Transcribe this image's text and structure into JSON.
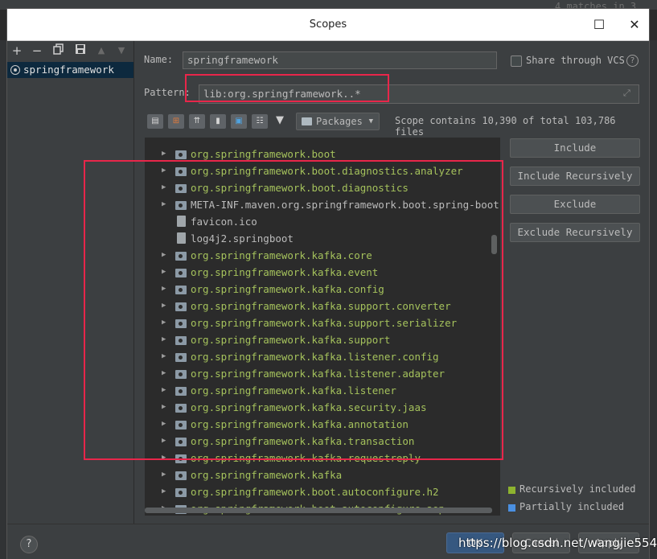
{
  "background": {
    "top_right_text": "4 matches in 3 fil"
  },
  "dialog": {
    "title": "Scopes",
    "maximize_glyph": "☐",
    "close_glyph": "✕"
  },
  "left_toolbar": {
    "icons": [
      "add-icon",
      "remove-icon",
      "copy-icon",
      "save-icon",
      "move-up-icon",
      "move-down-icon"
    ],
    "add": "+",
    "remove": "−",
    "up": "▲",
    "down": "▼"
  },
  "scopes": [
    {
      "label": "springframework",
      "selected": true
    }
  ],
  "form": {
    "name_label": "Name:",
    "name_value": "springframework",
    "share_label": "Share through VCS",
    "share_checked": false,
    "help_glyph": "?",
    "pattern_label": "Pattern:",
    "pattern_value": "lib:org.springframework..*"
  },
  "tree_toolbar": {
    "icons": [
      "flatten-packages-icon",
      "show-modules-icon",
      "show-module-groups-icon",
      "show-files-icon",
      "filter-legend-icon",
      "compact-packages-icon",
      "filter-icon"
    ],
    "packages_dropdown": "Packages",
    "scope_count": "Scope contains 10,390 of total 103,786 files"
  },
  "tree": {
    "rows": [
      {
        "type": "package",
        "text": "org.springframework.boot",
        "color": "#a5c25c"
      },
      {
        "type": "package",
        "text": "org.springframework.boot.diagnostics.analyzer",
        "color": "#a5c25c"
      },
      {
        "type": "package",
        "text": "org.springframework.boot.diagnostics",
        "color": "#a5c25c"
      },
      {
        "type": "package",
        "text": "META-INF.maven.org.springframework.boot.spring-boot",
        "color": "#bbbbbb"
      },
      {
        "type": "file",
        "text": "favicon.ico",
        "color": "#bbbbbb"
      },
      {
        "type": "file",
        "text": "log4j2.springboot",
        "color": "#bbbbbb"
      },
      {
        "type": "package",
        "text": "org.springframework.kafka.core",
        "color": "#a5c25c"
      },
      {
        "type": "package",
        "text": "org.springframework.kafka.event",
        "color": "#a5c25c"
      },
      {
        "type": "package",
        "text": "org.springframework.kafka.config",
        "color": "#a5c25c"
      },
      {
        "type": "package",
        "text": "org.springframework.kafka.support.converter",
        "color": "#a5c25c"
      },
      {
        "type": "package",
        "text": "org.springframework.kafka.support.serializer",
        "color": "#a5c25c"
      },
      {
        "type": "package",
        "text": "org.springframework.kafka.support",
        "color": "#a5c25c"
      },
      {
        "type": "package",
        "text": "org.springframework.kafka.listener.config",
        "color": "#a5c25c"
      },
      {
        "type": "package",
        "text": "org.springframework.kafka.listener.adapter",
        "color": "#a5c25c"
      },
      {
        "type": "package",
        "text": "org.springframework.kafka.listener",
        "color": "#a5c25c"
      },
      {
        "type": "package",
        "text": "org.springframework.kafka.security.jaas",
        "color": "#a5c25c"
      },
      {
        "type": "package",
        "text": "org.springframework.kafka.annotation",
        "color": "#a5c25c"
      },
      {
        "type": "package",
        "text": "org.springframework.kafka.transaction",
        "color": "#a5c25c"
      },
      {
        "type": "package",
        "text": "org.springframework.kafka.requestreply",
        "color": "#a5c25c"
      },
      {
        "type": "package",
        "text": "org.springframework.kafka",
        "color": "#a5c25c"
      },
      {
        "type": "package",
        "text": "org.springframework.boot.autoconfigure.h2",
        "color": "#a5c25c"
      },
      {
        "type": "package",
        "text": "org.springframework.boot.autoconfigure.aop",
        "color": "#a5c25c"
      }
    ]
  },
  "actions": {
    "include": "Include",
    "include_recursively": "Include Recursively",
    "exclude": "Exclude",
    "exclude_recursively": "Exclude Recursively"
  },
  "legend": [
    {
      "label": "Recursively included",
      "color": "#8db32f"
    },
    {
      "label": "Partially included",
      "color": "#4a90e2"
    }
  ],
  "footer": {
    "help_glyph": "?",
    "ok": "OK",
    "cancel": "Cancel",
    "apply": "Apply"
  },
  "watermark": "https://blog.csdn.net/wangjie5540"
}
